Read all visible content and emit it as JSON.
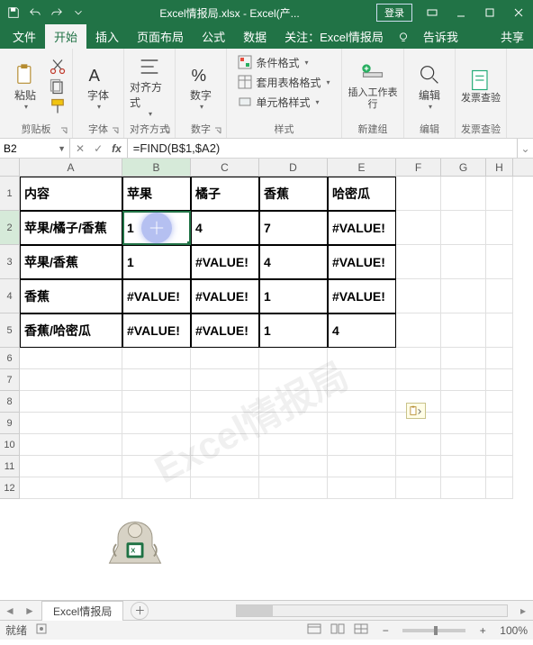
{
  "title": "Excel情报局.xlsx - Excel(产...",
  "login": "登录",
  "tabs": {
    "file": "文件",
    "home": "开始",
    "insert": "插入",
    "layout": "页面布局",
    "formulas": "公式",
    "data": "数据",
    "attention": "关注：Excel情报局",
    "tellme": "告诉我",
    "share": "共享"
  },
  "ribbon": {
    "clipboard": {
      "paste": "粘贴",
      "label": "剪贴板"
    },
    "font": {
      "btn": "字体",
      "label": "字体"
    },
    "align": {
      "btn": "对齐方式",
      "label": "对齐方式"
    },
    "number": {
      "btn": "数字",
      "label": "数字"
    },
    "styles": {
      "cond": "条件格式",
      "table": "套用表格格式",
      "cell": "单元格样式",
      "label": "样式"
    },
    "cells": {
      "insert": "插入工作表行",
      "label": "新建组"
    },
    "editing": {
      "btn": "编辑",
      "label": "编辑"
    },
    "invoice": {
      "btn": "发票查验",
      "label": "发票查验"
    }
  },
  "namebox": "B2",
  "formula": "=FIND(B$1,$A2)",
  "columns": [
    "A",
    "B",
    "C",
    "D",
    "E",
    "F",
    "G",
    "H"
  ],
  "table": {
    "headers": {
      "A": "内容",
      "B": "苹果",
      "C": "橘子",
      "D": "香蕉",
      "E": "哈密瓜"
    },
    "rows": [
      {
        "A": "苹果/橘子/香蕉",
        "B": "1",
        "C": "4",
        "D": "7",
        "E": "#VALUE!"
      },
      {
        "A": "苹果/香蕉",
        "B": "1",
        "C": "#VALUE!",
        "D": "4",
        "E": "#VALUE!"
      },
      {
        "A": "香蕉",
        "B": "#VALUE!",
        "C": "#VALUE!",
        "D": "1",
        "E": "#VALUE!"
      },
      {
        "A": "香蕉/哈密瓜",
        "B": "#VALUE!",
        "C": "#VALUE!",
        "D": "1",
        "E": "4"
      }
    ]
  },
  "sheetname": "Excel情报局",
  "status": "就绪",
  "zoom": "100%",
  "watermark": "Excel情报局"
}
